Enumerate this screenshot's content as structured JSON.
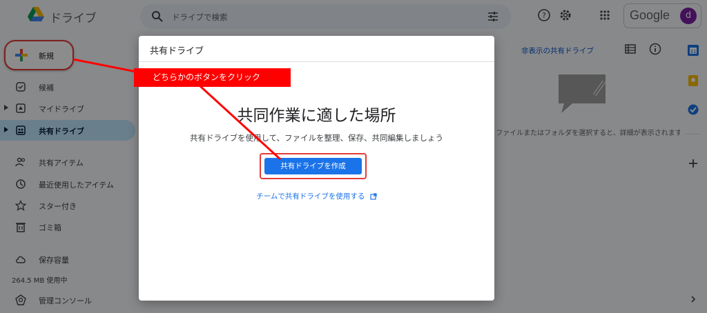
{
  "header": {
    "app_title": "ドライブ",
    "search_placeholder": "ドライブで検索",
    "google_text": "Google",
    "avatar_letter": "d"
  },
  "sidebar": {
    "new_label": "新規",
    "items": [
      {
        "label": "候補",
        "icon": "check-box-icon"
      },
      {
        "label": "マイドライブ",
        "icon": "my-drive-icon"
      },
      {
        "label": "共有ドライブ",
        "icon": "shared-drives-icon"
      },
      {
        "label": "共有アイテム",
        "icon": "people-icon"
      },
      {
        "label": "最近使用したアイテム",
        "icon": "clock-icon"
      },
      {
        "label": "スター付き",
        "icon": "star-icon"
      },
      {
        "label": "ゴミ箱",
        "icon": "trash-icon"
      },
      {
        "label": "保存容量",
        "icon": "cloud-icon"
      },
      {
        "label": "管理コンソール",
        "icon": "admin-icon"
      }
    ],
    "storage_used": "264.5 MB 使用中"
  },
  "right_panel": {
    "hidden_drives_link": "非表示の共有ドライブ",
    "details_text": "ファイルまたはフォルダを選択すると、詳細が表示されます"
  },
  "dialog": {
    "title": "共有ドライブ",
    "headline": "共同作業に適した場所",
    "subtitle": "共有ドライブを使用して、ファイルを整理、保存、共同編集しましょう",
    "create_button": "共有ドライブを作成",
    "team_link": "チームで共有ドライブを使用する"
  },
  "annotation": {
    "callout": "どちらかのボタンをクリック"
  },
  "colors": {
    "accent_blue": "#1a73e8",
    "annotation_red": "#ff0000",
    "active_nav": "#c2e7ff"
  }
}
